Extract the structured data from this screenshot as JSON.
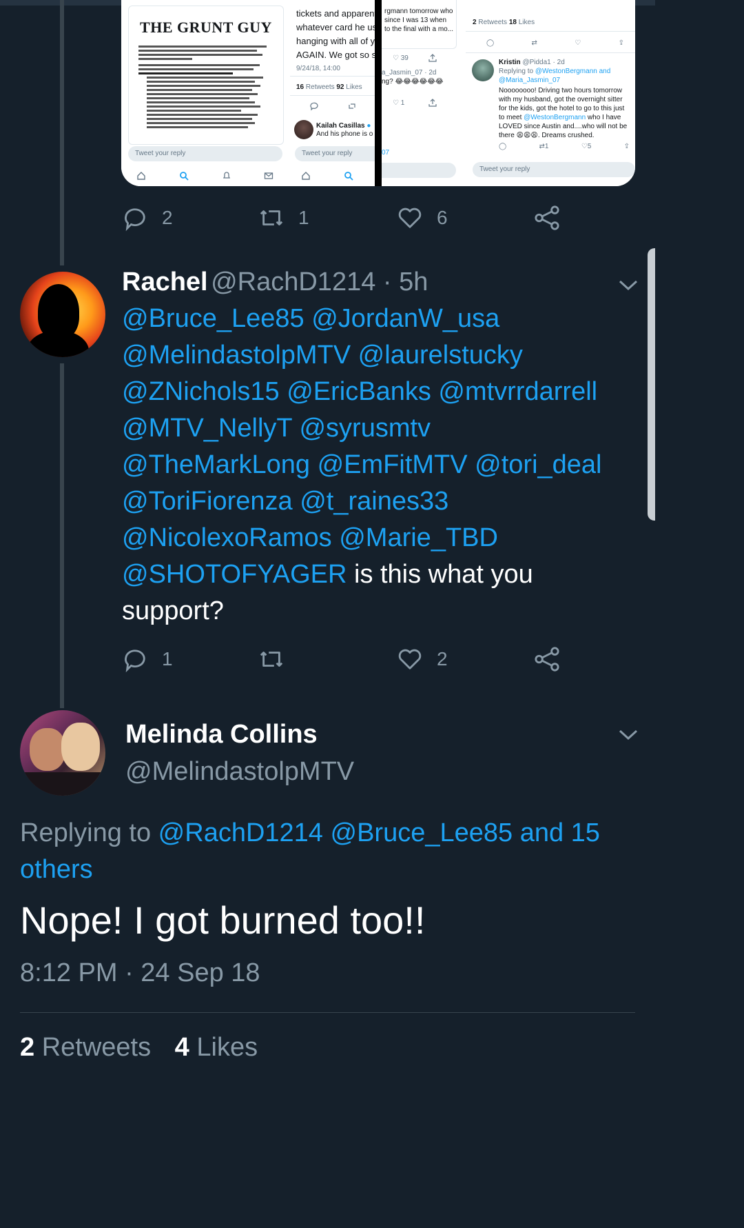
{
  "embedded": {
    "left_panel": {
      "doc_title": "THE GRUNT GUY",
      "reply_placeholder": "Tweet your reply"
    },
    "middle_panel": {
      "text_lines": [
        "tickets and apparent",
        "whatever card he use",
        "hanging with all of yo",
        "AGAIN. We got so sc"
      ],
      "timestamp": "9/24/18, 14:00",
      "retweets_count": "16",
      "retweets_label": "Retweets",
      "likes_count": "92",
      "likes_label": "Likes",
      "reply_user_name": "Kailah Casillas",
      "reply_text": "And his phone is o",
      "reply_placeholder": "Tweet your reply"
    },
    "third_panel": {
      "text_lines": [
        "rgmann tomorrow who",
        "since I was 13 when",
        "to the final with a mo..."
      ],
      "like_count": "39",
      "reply_handle": "a_Jasmin_07 · 2d",
      "reply_text": "ng? 😂😂😂😂😂😂",
      "reply_like_count": "1",
      "link_fragment": "07"
    },
    "right_panel": {
      "retweets_count": "2",
      "retweets_label": "Retweets",
      "likes_count": "18",
      "likes_label": "Likes",
      "user_name": "Kristin",
      "user_handle": "@Pidda1 · 2d",
      "replying_prefix": "Replying to ",
      "replying_handles": "@WestonBergmann and @Maria_Jasmin_07",
      "body_1": "Noooooooo! Driving two hours tomorrow with my husband, got the overnight sitter for the kids, got the hotel to go to this just to meet ",
      "body_mention": "@WestonBergmann",
      "body_2": " who I have LOVED since Austin and....who will not be there 😩😩😩. Dreams crushed.",
      "retweet_count": "1",
      "like_count": "5",
      "reply_placeholder": "Tweet your reply"
    }
  },
  "tweet1_actions": {
    "replies": "2",
    "retweets": "1",
    "likes": "6"
  },
  "tweet2": {
    "name": "Rachel",
    "handle": "@RachD1214 · 5h",
    "lines": [
      {
        "mention": "@Bruce_Lee85 @JordanW_usa",
        "text": ""
      },
      {
        "mention": "@MelindastolpMTV @laurelstucky",
        "text": ""
      },
      {
        "mention": "@ZNichols15 @EricBanks @mtvrrdarrell",
        "text": ""
      },
      {
        "mention": "@MTV_NellyT @syrusmtv",
        "text": ""
      },
      {
        "mention": "@TheMarkLong @EmFitMTV @tori_deal",
        "text": ""
      },
      {
        "mention": "@ToriFiorenza @t_raines33",
        "text": ""
      },
      {
        "mention": "@NicolexoRamos @Marie_TBD",
        "text": ""
      },
      {
        "mention": "@SHOTOFYAGER",
        "text": " is this what you"
      },
      {
        "mention": "",
        "text": "support?"
      }
    ],
    "replies": "1",
    "retweets": "",
    "likes": "2"
  },
  "tweet3": {
    "name": "Melinda Collins",
    "handle": "@MelindastolpMTV",
    "replying_prefix": "Replying to ",
    "replying_line1": "@RachD1214 @Bruce_Lee85 and 15",
    "replying_line2": "others",
    "text": "Nope! I got burned too!!",
    "timestamp": "8:12 PM · 24 Sep 18",
    "retweets_count": "2",
    "retweets_label": "Retweets",
    "likes_count": "4",
    "likes_label": "Likes"
  },
  "colors": {
    "background": "#15202b",
    "accent": "#1da1f2",
    "secondary_text": "#8899a6",
    "divider": "#38444d"
  }
}
